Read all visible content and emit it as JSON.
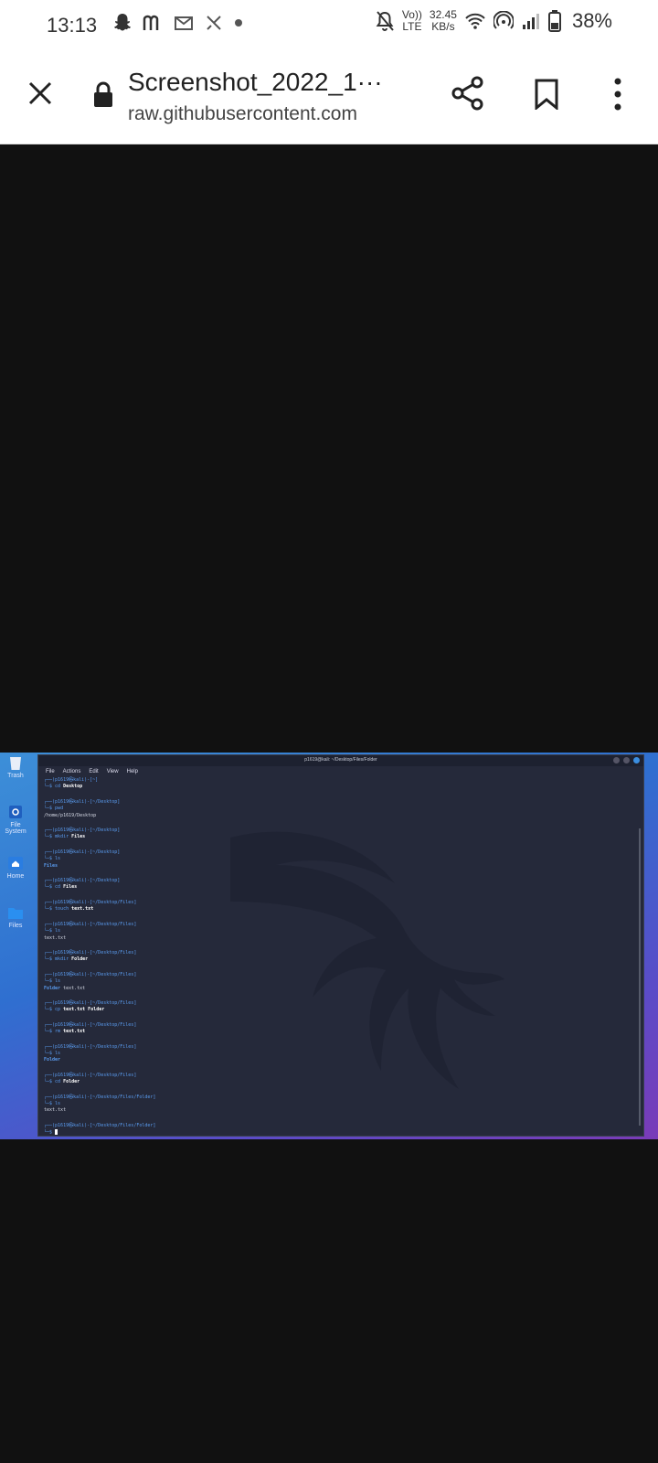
{
  "status_bar": {
    "time": "13:13",
    "network_line1": "Vo))",
    "network_line2": "LTE",
    "speed_line1": "32.45",
    "speed_line2": "KB/s",
    "battery": "38%"
  },
  "url_bar": {
    "title": "Screenshot_2022_1···",
    "host": "raw.githubusercontent.com"
  },
  "desktop": {
    "icons": [
      "Trash",
      "File System",
      "Home",
      "Files"
    ],
    "terminal": {
      "window_title": "p1619@kali: ~/Desktop/Files/Folder",
      "menu": [
        "File",
        "Actions",
        "Edit",
        "View",
        "Help"
      ],
      "blocks": [
        {
          "prompt": "┌──(p1619㉿kali)-[~]",
          "cmd_sym": "└─$ ",
          "cmd_word": "cd",
          "cmd_arg": " Desktop",
          "output": "",
          "output_blue": ""
        },
        {
          "prompt": "┌──(p1619㉿kali)-[~/Desktop]",
          "cmd_sym": "└─$ ",
          "cmd_word": "pwd",
          "cmd_arg": "",
          "output": "/home/p1619/Desktop",
          "output_blue": ""
        },
        {
          "prompt": "┌──(p1619㉿kali)-[~/Desktop]",
          "cmd_sym": "└─$ ",
          "cmd_word": "mkdir",
          "cmd_arg": " Files",
          "output": "",
          "output_blue": ""
        },
        {
          "prompt": "┌──(p1619㉿kali)-[~/Desktop]",
          "cmd_sym": "└─$ ",
          "cmd_word": "ls",
          "cmd_arg": "",
          "output": "",
          "output_blue": "Files"
        },
        {
          "prompt": "┌──(p1619㉿kali)-[~/Desktop]",
          "cmd_sym": "└─$ ",
          "cmd_word": "cd",
          "cmd_arg": " Files",
          "output": "",
          "output_blue": ""
        },
        {
          "prompt": "┌──(p1619㉿kali)-[~/Desktop/Files]",
          "cmd_sym": "└─$ ",
          "cmd_word": "touch",
          "cmd_arg": " text.txt",
          "output": "",
          "output_blue": ""
        },
        {
          "prompt": "┌──(p1619㉿kali)-[~/Desktop/Files]",
          "cmd_sym": "└─$ ",
          "cmd_word": "ls",
          "cmd_arg": "",
          "output": "text.txt",
          "output_blue": ""
        },
        {
          "prompt": "┌──(p1619㉿kali)-[~/Desktop/Files]",
          "cmd_sym": "└─$ ",
          "cmd_word": "mkdir",
          "cmd_arg": " Folder",
          "output": "",
          "output_blue": ""
        },
        {
          "prompt": "┌──(p1619㉿kali)-[~/Desktop/Files]",
          "cmd_sym": "└─$ ",
          "cmd_word": "ls",
          "cmd_arg": "",
          "output": "  text.txt",
          "output_blue": "Folder"
        },
        {
          "prompt": "┌──(p1619㉿kali)-[~/Desktop/Files]",
          "cmd_sym": "└─$ ",
          "cmd_word": "cp",
          "cmd_arg": " text.txt Folder",
          "output": "",
          "output_blue": ""
        },
        {
          "prompt": "┌──(p1619㉿kali)-[~/Desktop/Files]",
          "cmd_sym": "└─$ ",
          "cmd_word": "rm",
          "cmd_arg": " text.txt",
          "output": "",
          "output_blue": ""
        },
        {
          "prompt": "┌──(p1619㉿kali)-[~/Desktop/Files]",
          "cmd_sym": "└─$ ",
          "cmd_word": "ls",
          "cmd_arg": "",
          "output": "",
          "output_blue": "Folder"
        },
        {
          "prompt": "┌──(p1619㉿kali)-[~/Desktop/Files]",
          "cmd_sym": "└─$ ",
          "cmd_word": "cd",
          "cmd_arg": " Folder",
          "output": "",
          "output_blue": ""
        },
        {
          "prompt": "┌──(p1619㉿kali)-[~/Desktop/Files/Folder]",
          "cmd_sym": "└─$ ",
          "cmd_word": "ls",
          "cmd_arg": "",
          "output": "text.txt",
          "output_blue": ""
        }
      ],
      "last_prompt": "┌──(p1619㉿kali)-[~/Desktop/Files/Folder]",
      "last_cmd_sym": "└─$ "
    }
  }
}
